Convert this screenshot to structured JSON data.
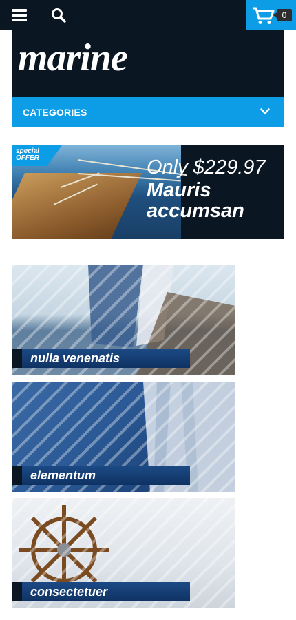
{
  "header": {
    "menu_icon": "hamburger-icon",
    "search_icon": "search-icon",
    "cart": {
      "icon": "shopping-cart-icon",
      "count": "0"
    }
  },
  "brand": {
    "logo_text": "marine"
  },
  "categories": {
    "label": "CATEGORIES",
    "icon": "chevron-down-icon"
  },
  "offer": {
    "badge_line1": "special",
    "badge_line2": "OFFER",
    "price": "Only $229.97",
    "title": "Mauris accumsan"
  },
  "tiles": [
    {
      "caption": "nulla venenatis"
    },
    {
      "caption": "elementum"
    },
    {
      "caption": "consectetuer"
    }
  ],
  "colors": {
    "accent": "#0d9de6",
    "dark": "#0b1623",
    "caption": "#1c4a85"
  }
}
